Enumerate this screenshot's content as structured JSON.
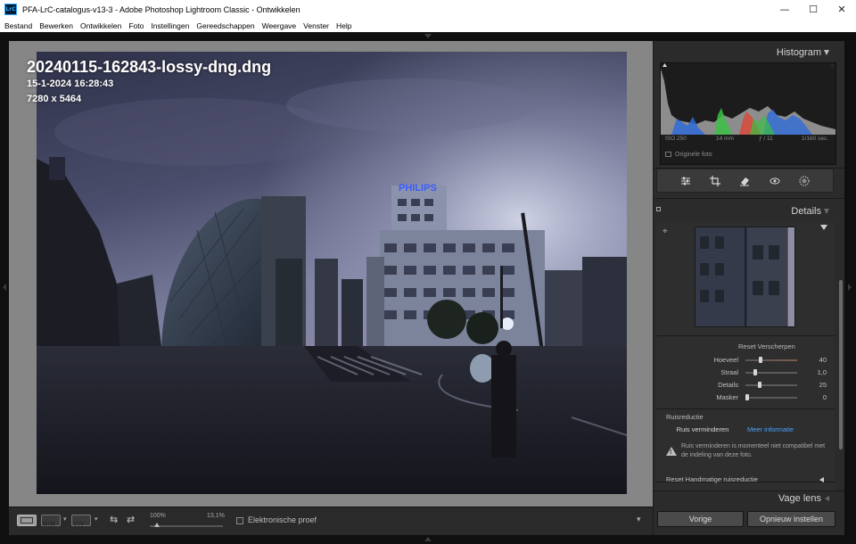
{
  "window": {
    "title": "PFA-LrC-catalogus-v13-3 - Adobe Photoshop Lightroom Classic - Ontwikkelen",
    "app_icon": "LrC",
    "minimize": "—",
    "maximize": "☐",
    "close": "✕"
  },
  "menu": [
    "Bestand",
    "Bewerken",
    "Ontwikkelen",
    "Foto",
    "Instellingen",
    "Gereedschappen",
    "Weergave",
    "Venster",
    "Help"
  ],
  "photo_info": {
    "filename": "20240115-162843-lossy-dng.dng",
    "datetime": "15-1-2024 16:28:43",
    "dimensions": "7280 x 5464",
    "sign_text": "PHILIPS"
  },
  "toolbar": {
    "zoom_left": "100%",
    "zoom_right": "13,1%",
    "zoom_level": 0.1,
    "soft_proof_label": "Elektronische proef",
    "soft_proof_checked": false
  },
  "histogram": {
    "title": "Histogram",
    "iso": "ISO 250",
    "focal": "14 mm",
    "aperture": "ƒ / 11",
    "shutter": "1/160 sec.",
    "original_photo": "Originele foto"
  },
  "tools": [
    "adjust-sliders-icon",
    "crop-icon",
    "eraser-icon",
    "red-eye-icon",
    "masking-icon"
  ],
  "details": {
    "title": "Details",
    "sharpen_header": "Reset Verscherpen",
    "sliders": [
      {
        "label": "Hoeveel",
        "value": "40",
        "fraction": 0.27
      },
      {
        "label": "Straal",
        "value": "1,0",
        "fraction": 0.17
      },
      {
        "label": "Details",
        "value": "25",
        "fraction": 0.25
      },
      {
        "label": "Masker",
        "value": "0",
        "fraction": 0.0
      }
    ],
    "noise_title": "Ruisreductie",
    "noise_button": "Ruis verminderen",
    "noise_link": "Meer informatie",
    "noise_warning": "Ruis verminderen is momenteel niet compatibel met de indeling van deze foto.",
    "manual_noise": "Reset Handmatige ruisreductie"
  },
  "lens": {
    "title": "Vage lens"
  },
  "buttons": {
    "previous": "Vorige",
    "reset": "Opnieuw instellen"
  }
}
